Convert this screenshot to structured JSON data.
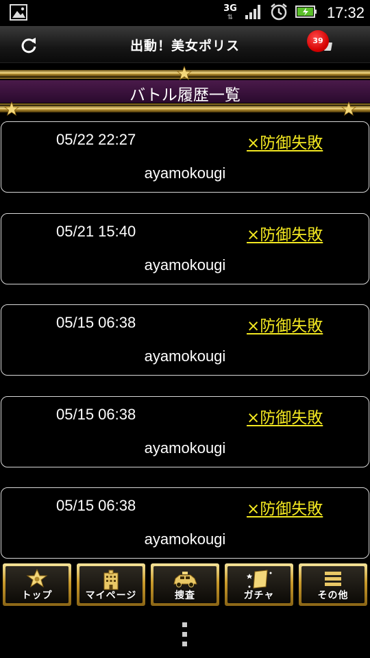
{
  "status_bar": {
    "network": "3G",
    "time": "17:32"
  },
  "header": {
    "title": "出動！美女ポリス",
    "notification_count": "39"
  },
  "page": {
    "title": "バトル履歴一覧"
  },
  "battles": [
    {
      "datetime": "05/22 22:27",
      "result": "×防御失敗",
      "opponent": "ayamokougi"
    },
    {
      "datetime": "05/21 15:40",
      "result": "×防御失敗",
      "opponent": "ayamokougi"
    },
    {
      "datetime": "05/15 06:38",
      "result": "×防御失敗",
      "opponent": "ayamokougi"
    },
    {
      "datetime": "05/15 06:38",
      "result": "×防御失敗",
      "opponent": "ayamokougi"
    },
    {
      "datetime": "05/15 06:38",
      "result": "×防御失敗",
      "opponent": "ayamokougi"
    }
  ],
  "nav": [
    {
      "label": "トップ",
      "icon": "police-badge-icon"
    },
    {
      "label": "マイページ",
      "icon": "building-icon"
    },
    {
      "label": "捜査",
      "icon": "police-car-icon"
    },
    {
      "label": "ガチャ",
      "icon": "gacha-card-icon"
    },
    {
      "label": "その他",
      "icon": "menu-lines-icon"
    }
  ],
  "colors": {
    "result_text": "#f3e821",
    "banner_purple": "#3a103e",
    "gold": "#d8b04a",
    "badge_red": "#d40000"
  }
}
